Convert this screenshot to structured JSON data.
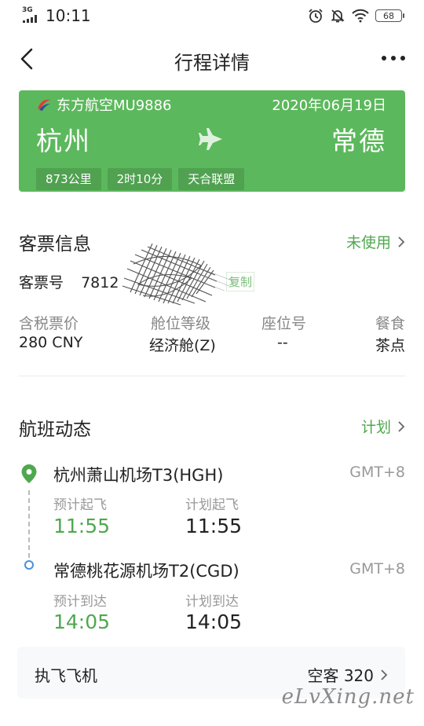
{
  "status_bar": {
    "network": "3G",
    "time": "10:11",
    "battery": "68"
  },
  "nav": {
    "title": "行程详情"
  },
  "flight_card": {
    "airline_flight": "东方航空MU9886",
    "date": "2020年06月19日",
    "from_city": "杭州",
    "to_city": "常德",
    "tags": [
      "873公里",
      "2时10分",
      "天合联盟"
    ],
    "color": "#5cb85c"
  },
  "ticket_info": {
    "title": "客票信息",
    "status_link": "未使用",
    "ticket_no_label": "客票号",
    "ticket_no_value": "7812",
    "copy_label": "复制",
    "columns": [
      {
        "label": "含税票价",
        "value": "280 CNY"
      },
      {
        "label": "舱位等级",
        "value": "经济舱(Z)"
      },
      {
        "label": "座位号",
        "value": "--"
      },
      {
        "label": "餐食",
        "value": "茶点"
      }
    ]
  },
  "flight_status": {
    "title": "航班动态",
    "status_link": "计划",
    "departure": {
      "airport": "杭州萧山机场T3(HGH)",
      "timezone": "GMT+8",
      "est_label": "预计起飞",
      "est_time": "11:55",
      "plan_label": "计划起飞",
      "plan_time": "11:55"
    },
    "arrival": {
      "airport": "常德桃花源机场T2(CGD)",
      "timezone": "GMT+8",
      "est_label": "预计到达",
      "est_time": "14:05",
      "plan_label": "计划到达",
      "plan_time": "14:05"
    },
    "aircraft_label": "执飞飞机",
    "aircraft_type": "空客 320"
  },
  "watermark": "eLvXing.net",
  "accent_color": "#4fa84f"
}
